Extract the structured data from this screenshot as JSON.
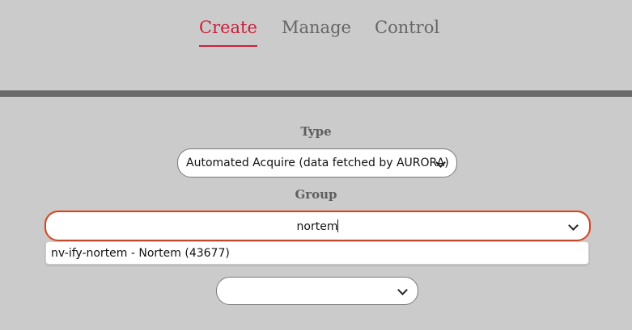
{
  "tabs": [
    {
      "label": "Create",
      "active": true
    },
    {
      "label": "Manage",
      "active": false
    },
    {
      "label": "Control",
      "active": false
    }
  ],
  "form": {
    "type": {
      "label": "Type",
      "selected": "Automated Acquire (data fetched by AURORA)"
    },
    "group": {
      "label": "Group",
      "value": "nortem",
      "suggestions": [
        "nv-ify-nortem - Nortem (43677)"
      ]
    },
    "third_select": {
      "selected": ""
    }
  },
  "colors": {
    "background": "#cbcbcb",
    "accent": "#cc1f3b",
    "divider": "#6b6b6b",
    "focus_border": "#c44a2c"
  },
  "icons": {
    "dropdown": "chevron-down-icon"
  }
}
